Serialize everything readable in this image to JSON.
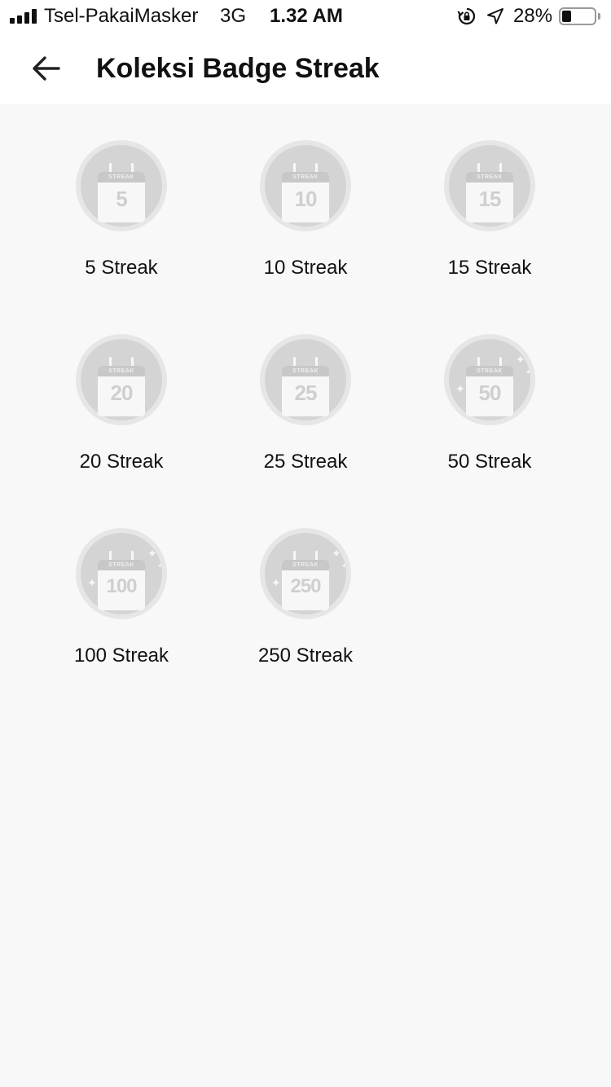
{
  "status_bar": {
    "carrier": "Tsel-PakaiMasker",
    "network": "3G",
    "time": "1.32 AM",
    "battery_percent": "28%",
    "battery_level": 0.28,
    "icons": [
      "signal-icon",
      "rotation-lock-icon",
      "location-arrow-icon",
      "battery-icon"
    ]
  },
  "header": {
    "back_icon": "arrow-left-icon",
    "title": "Koleksi Badge Streak"
  },
  "badge_word": "STREAK",
  "badges": [
    {
      "number": "5",
      "label": "5 Streak"
    },
    {
      "number": "10",
      "label": "10 Streak"
    },
    {
      "number": "15",
      "label": "15 Streak"
    },
    {
      "number": "20",
      "label": "20 Streak"
    },
    {
      "number": "25",
      "label": "25 Streak"
    },
    {
      "number": "50",
      "label": "50 Streak"
    },
    {
      "number": "100",
      "label": "100 Streak"
    },
    {
      "number": "250",
      "label": "250 Streak"
    }
  ],
  "colors": {
    "background": "#f8f8f8",
    "header": "#ffffff",
    "badge_locked": "#d4d4d4",
    "text": "#111111"
  }
}
